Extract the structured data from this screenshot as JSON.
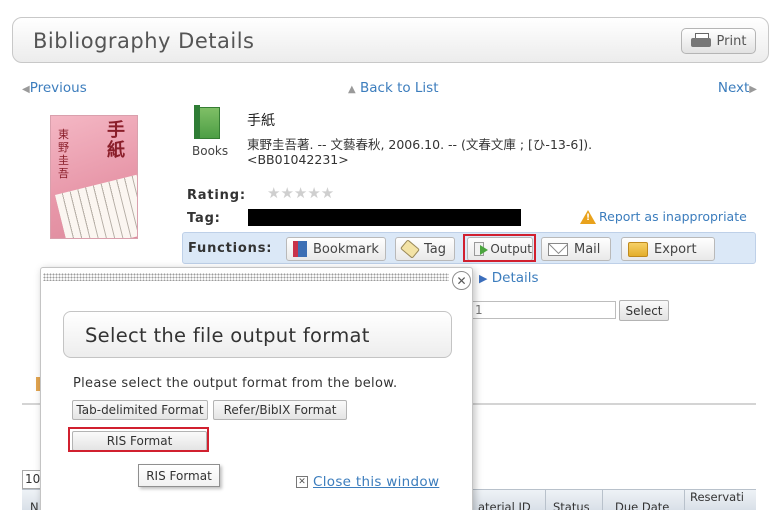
{
  "header": {
    "title": "Bibliography Details",
    "print_label": "Print"
  },
  "nav": {
    "previous": "Previous",
    "back_to_list": "Back to List",
    "next": "Next"
  },
  "record": {
    "material_type": "Books",
    "title": "手紙",
    "description": "東野圭吾著. -- 文藝春秋, 2006.10. -- (文春文庫 ; [ひ-13-6]).",
    "record_id": "<BB01042231>",
    "cover": {
      "title": "手紙",
      "author": "東野圭吾"
    }
  },
  "rating": {
    "label": "Rating:",
    "stars": "★★★★★",
    "value": 0,
    "max": 5
  },
  "tag": {
    "label": "Tag:"
  },
  "report_link": "Report as inappropriate",
  "functions": {
    "label": "Functions:",
    "bookmark": "Bookmark",
    "tag": "Tag",
    "output": "Output",
    "mail": "Mail",
    "export": "Export"
  },
  "background": {
    "details_link": "Details",
    "input_value": "1",
    "select_button": "Select",
    "per_page_value": "10",
    "table_headers": {
      "n": "N",
      "material_id": "aterial ID",
      "status": "Status",
      "due_date": "Due Date",
      "reservation": "Reservati"
    }
  },
  "modal": {
    "title": "Select the file output format",
    "instruction": "Please select the output format from the below.",
    "formats": {
      "tab_delimited": "Tab-delimited Format",
      "refer_bibix": "Refer/BibIX Format",
      "ris": "RIS Format"
    },
    "tooltip": "RIS Format",
    "close_window": "Close this window",
    "close_icon_glyph": "✕",
    "close_window_icon_glyph": "✕"
  },
  "colors": {
    "link": "#3c7dbd",
    "highlight": "#d1202f",
    "functions_bar": "#dbe8f7"
  }
}
